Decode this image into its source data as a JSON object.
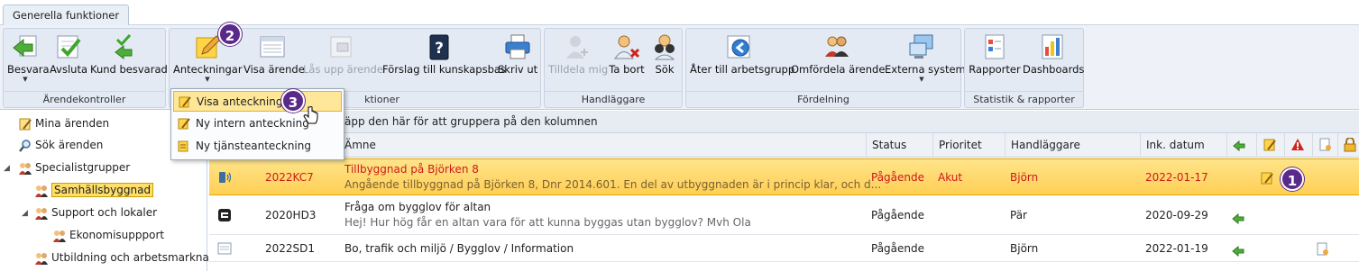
{
  "tab": {
    "label": "Generella funktioner"
  },
  "ribbon": {
    "groups": [
      {
        "title": "Ärendekontroller",
        "buttons": [
          {
            "label": "Besvara",
            "icon": "reply-green-arrow-icon"
          },
          {
            "label": "Avsluta",
            "icon": "checkmark-document-icon"
          },
          {
            "label": "Kund besvarad",
            "icon": "checkmark-reply-icon"
          }
        ]
      },
      {
        "title": "Ärendefunktioner",
        "title_visible": "ktioner",
        "buttons": [
          {
            "label": "Anteckningar",
            "icon": "notes-pencil-icon"
          },
          {
            "label": "Visa ärende",
            "icon": "view-case-icon"
          },
          {
            "label": "Lås upp ärende",
            "icon": "unlock-case-icon"
          },
          {
            "label": "Förslag till kunskapsbas",
            "icon": "knowledge-book-icon"
          },
          {
            "label": "Skriv ut",
            "icon": "printer-icon"
          }
        ]
      },
      {
        "title": "Handläggare",
        "buttons": [
          {
            "label": "Tilldela mig",
            "icon": "assign-me-icon"
          },
          {
            "label": "Ta bort",
            "icon": "remove-user-icon"
          },
          {
            "label": "Sök",
            "icon": "binoculars-icon"
          }
        ]
      },
      {
        "title": "Fördelning",
        "buttons": [
          {
            "label": "Åter till arbetsgrupp",
            "icon": "return-to-group-icon"
          },
          {
            "label": "Omfördela ärende",
            "icon": "reassign-users-icon"
          },
          {
            "label": "Externa system",
            "icon": "external-systems-icon"
          }
        ]
      },
      {
        "title": "Statistik & rapporter",
        "buttons": [
          {
            "label": "Rapporter",
            "icon": "report-icon"
          },
          {
            "label": "Dashboards",
            "icon": "dashboard-icon"
          }
        ]
      }
    ]
  },
  "dropdown": {
    "items": [
      {
        "label": "Visa anteckningar"
      },
      {
        "label": "Ny intern anteckning"
      },
      {
        "label": "Ny tjänsteanteckning"
      }
    ]
  },
  "badges": [
    "1",
    "2",
    "3"
  ],
  "tree": {
    "items": [
      {
        "label": "Mina ärenden"
      },
      {
        "label": "Sök ärenden"
      },
      {
        "label": "Specialistgrupper"
      },
      {
        "label": "Samhällsbyggnad"
      },
      {
        "label": "Support och lokaler"
      },
      {
        "label": "Ekonomisuppport"
      },
      {
        "label": "Utbildning och arbetsmarknad"
      }
    ]
  },
  "grid": {
    "group_hint": "ra rubriken för en kolumn hit och släpp den här för att gruppera på den kolumnen",
    "group_hint_visible": "äpp den här för att gruppera på den kolumnen",
    "columns": {
      "subject": "Ämne",
      "status": "Status",
      "priority": "Prioritet",
      "handler": "Handläggare",
      "date": "Ink. datum"
    },
    "rows": [
      {
        "id": "2022KC7",
        "title": "Tillbyggnad på Björken 8",
        "desc": "Angående tillbyggnad på Björken 8, Dnr 2014.601. En del av utbyggnaden är i princip klar, och d...",
        "status": "Pågående",
        "priority": "Akut",
        "handler": "Björn",
        "date": "2022-01-17"
      },
      {
        "id": "2020HD3",
        "title": "Fråga om bygglov för altan",
        "desc": "Hej! Hur hög får en altan vara för att kunna byggas utan bygglov? Mvh Ola",
        "status": "Pågående",
        "priority": "",
        "handler": "Pär",
        "date": "2020-09-29"
      },
      {
        "id": "2022SD1",
        "title": "Bo, trafik och miljö / Bygglov / Information",
        "desc": "",
        "status": "Pågående",
        "priority": "",
        "handler": "Björn",
        "date": "2022-01-19"
      }
    ]
  },
  "colors": {
    "highlight": "#ffd86b",
    "urgent_text": "#cc1a1a",
    "badge": "#5a2a8a"
  }
}
